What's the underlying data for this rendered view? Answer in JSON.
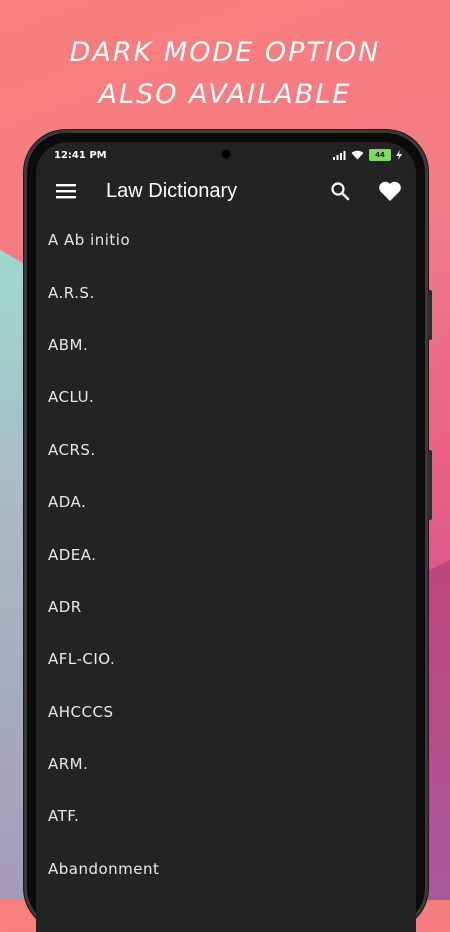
{
  "promo": {
    "line1": "DARK MODE OPTION",
    "line2": "ALSO AVAILABLE"
  },
  "status_bar": {
    "time": "12:41 PM",
    "battery": "44"
  },
  "app_bar": {
    "title": "Law Dictionary",
    "menu_icon": "menu-icon",
    "search_icon": "search-icon",
    "favorite_icon": "heart-icon"
  },
  "terms": [
    "A Ab initio",
    "A.R.S.",
    "ABM.",
    "ACLU.",
    "ACRS.",
    "ADA.",
    "ADEA.",
    "ADR",
    "AFL-CIO.",
    "AHCCCS",
    "ARM.",
    "ATF.",
    "Abandonment"
  ],
  "colors": {
    "screen_bg": "#232323",
    "text": "#e9e9e9",
    "accent_pink": "#f47a86",
    "teal": "#9ed8cf"
  }
}
